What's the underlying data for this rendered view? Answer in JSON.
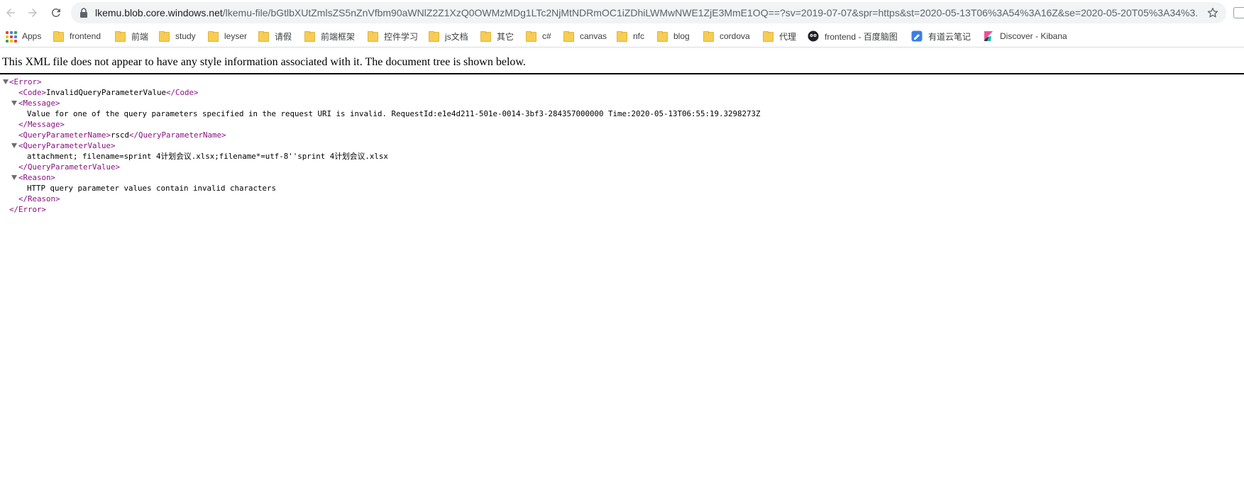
{
  "browser": {
    "url_host": "lkemu.blob.core.windows.net",
    "url_rest": "/lkemu-file/bGtlbXUtZmlsZS5nZnVfbm90aWNlZ2Z1XzQ0OWMzMDg1LTc2NjMtNDRmOC1iZDhiLWMwNWE1ZjE3MmE1OQ==?sv=2019-07-07&spr=https&st=2020-05-13T06%3A54%3A16Z&se=2020-05-20T05%3A34%3..."
  },
  "bookmarks": [
    {
      "label": "Apps",
      "icon": "apps-icon"
    },
    {
      "label": "frontend",
      "icon": "folder-icon"
    },
    {
      "label": "前端",
      "icon": "folder-icon"
    },
    {
      "label": "study",
      "icon": "folder-icon"
    },
    {
      "label": "leyser",
      "icon": "folder-icon"
    },
    {
      "label": "请假",
      "icon": "folder-icon"
    },
    {
      "label": "前端框架",
      "icon": "folder-icon"
    },
    {
      "label": "控件学习",
      "icon": "folder-icon"
    },
    {
      "label": "js文档",
      "icon": "folder-icon"
    },
    {
      "label": "其它",
      "icon": "folder-icon"
    },
    {
      "label": "c#",
      "icon": "folder-icon"
    },
    {
      "label": "canvas",
      "icon": "folder-icon"
    },
    {
      "label": "nfc",
      "icon": "folder-icon"
    },
    {
      "label": "blog",
      "icon": "folder-icon"
    },
    {
      "label": "cordova",
      "icon": "folder-icon"
    },
    {
      "label": "代理",
      "icon": "folder-icon"
    },
    {
      "label": "frontend - 百度脑图",
      "icon": "baidu-naotu-icon"
    },
    {
      "label": "有道云笔记",
      "icon": "youdao-note-icon"
    },
    {
      "label": "Discover - Kibana",
      "icon": "kibana-icon"
    }
  ],
  "xml_notice": "This XML file does not appear to have any style information associated with it. The document tree is shown below.",
  "xml": {
    "error_open": "<Error>",
    "code_open": "<Code>",
    "code_value": "InvalidQueryParameterValue",
    "code_close": "</Code>",
    "message_open": "<Message>",
    "message_value": "Value for one of the query parameters specified in the request URI is invalid. RequestId:e1e4d211-501e-0014-3bf3-284357000000 Time:2020-05-13T06:55:19.3298273Z",
    "message_close": "</Message>",
    "qpn_open": "<QueryParameterName>",
    "qpn_value": "rscd",
    "qpn_close": "</QueryParameterName>",
    "qpv_open": "<QueryParameterValue>",
    "qpv_value": "attachment; filename=sprint 4计划会议.xlsx;filename*=utf-8''sprint 4计划会议.xlsx",
    "qpv_close": "</QueryParameterValue>",
    "reason_open": "<Reason>",
    "reason_value": "HTTP query parameter values contain invalid characters",
    "reason_close": "</Reason>",
    "error_close": "</Error>"
  },
  "colors": {
    "tag": "#881280",
    "omnibox": "#f1f3f4",
    "folder": "#f6cd54"
  }
}
